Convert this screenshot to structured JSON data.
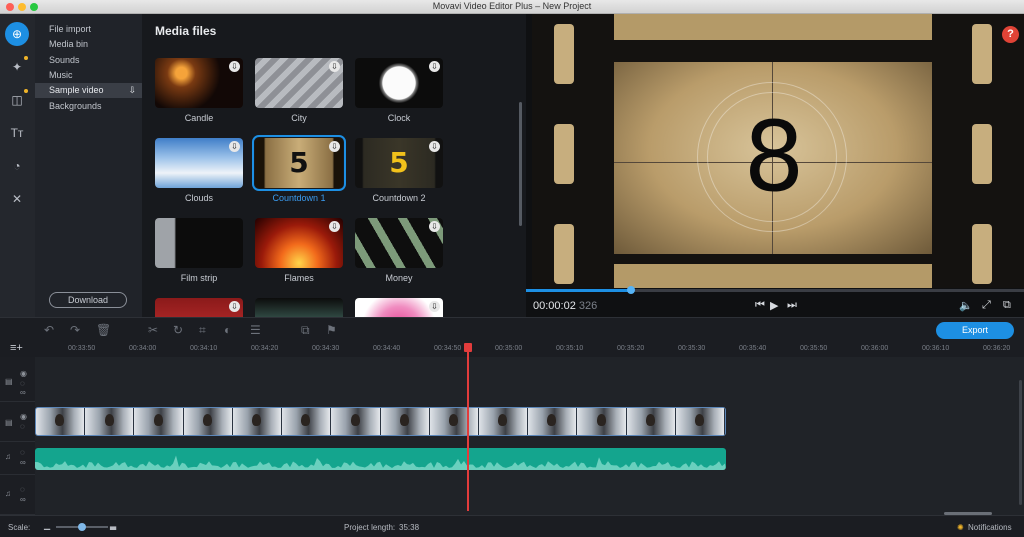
{
  "window": {
    "title": "Movavi Video Editor Plus – New Project"
  },
  "left_icons": [
    {
      "name": "import-icon",
      "glyph": "⊕",
      "active": true
    },
    {
      "name": "magic-wand-icon",
      "glyph": "✦",
      "badge": true
    },
    {
      "name": "transitions-icon",
      "glyph": "◫",
      "badge": true
    },
    {
      "name": "titles-icon",
      "glyph": "Tт"
    },
    {
      "name": "stickers-icon",
      "glyph": "◔"
    },
    {
      "name": "tools-icon",
      "glyph": "✕"
    }
  ],
  "sidebar": {
    "items": [
      {
        "label": "File import"
      },
      {
        "label": "Media bin"
      },
      {
        "label": "Sounds"
      },
      {
        "label": "Music"
      },
      {
        "label": "Sample video",
        "active": true,
        "icon": "⇩"
      },
      {
        "label": "Backgrounds"
      }
    ],
    "download_label": "Download"
  },
  "media": {
    "title": "Media files",
    "tiles": [
      {
        "label": "Candle",
        "download": true
      },
      {
        "label": "City",
        "download": true
      },
      {
        "label": "Clock",
        "download": true
      },
      {
        "label": "Clouds",
        "download": true
      },
      {
        "label": "Countdown 1",
        "download": true,
        "selected": true,
        "overlay": "5"
      },
      {
        "label": "Countdown 2",
        "download": true,
        "overlay": "5"
      },
      {
        "label": "Film strip",
        "download": false
      },
      {
        "label": "Flames",
        "download": true
      },
      {
        "label": "Money",
        "download": true
      },
      {
        "label": "",
        "download": true
      },
      {
        "label": "",
        "download": false
      },
      {
        "label": "",
        "download": true
      }
    ]
  },
  "preview": {
    "number": "8",
    "help": "?",
    "timecode": "00:00:02",
    "timecode_ms": "326",
    "progress_fraction": 0.21
  },
  "toolbar": {
    "export_label": "Export"
  },
  "ruler": {
    "ticks": [
      "00:33:50",
      "00:34:00",
      "00:34:10",
      "00:34:20",
      "00:34:30",
      "00:34:40",
      "00:34:50",
      "00:35:00",
      "00:35:10",
      "00:35:20",
      "00:35:30",
      "00:35:40",
      "00:35:50",
      "00:36:00",
      "00:36:10",
      "00:36:20"
    ]
  },
  "status": {
    "scale_label": "Scale:",
    "project_length_label": "Project length:",
    "project_length": "35:38",
    "notifications_label": "Notifications"
  },
  "colors": {
    "accent": "#1d8fe3",
    "audio": "#14a58e",
    "playhead": "#e23c3c"
  }
}
